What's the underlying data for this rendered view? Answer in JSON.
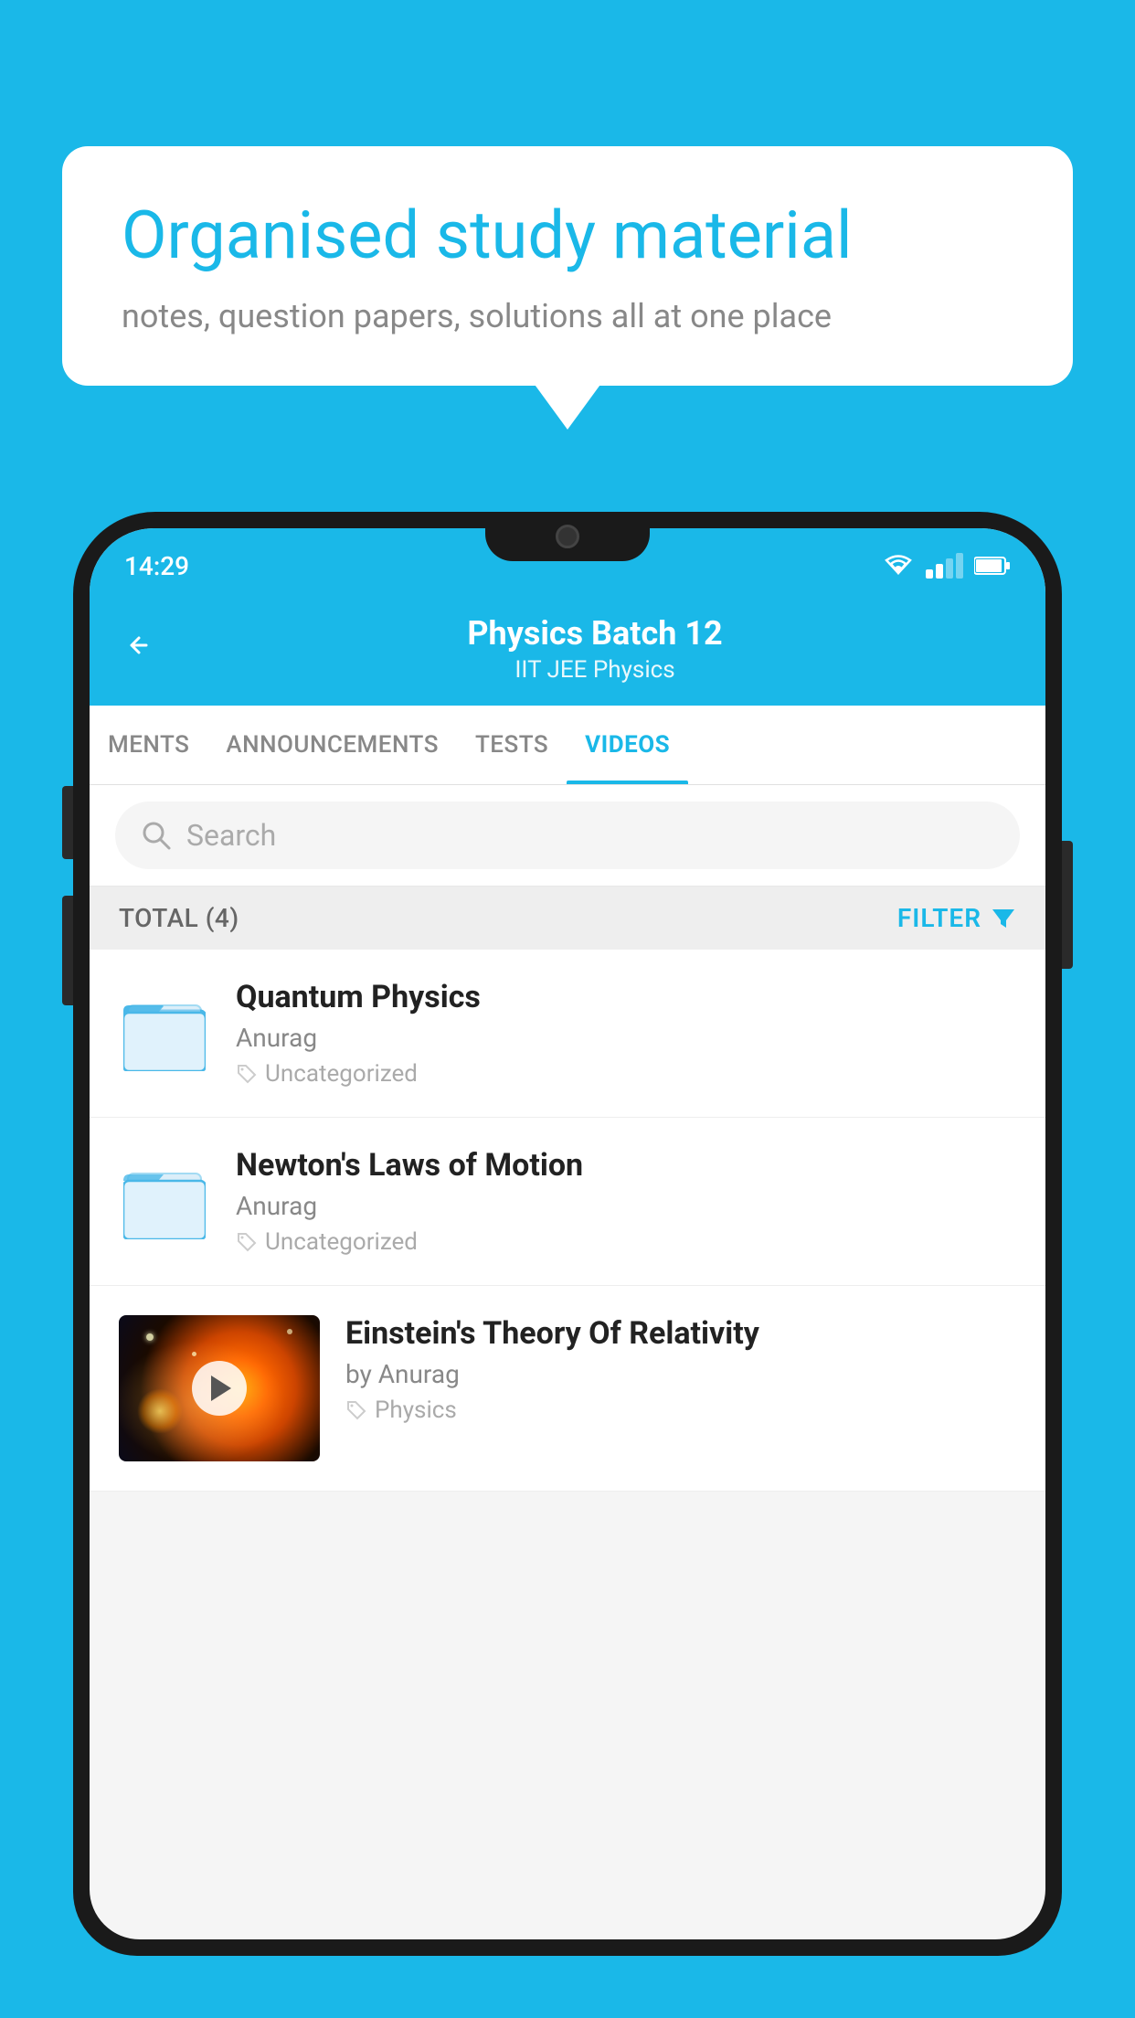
{
  "background_color": "#1ab8e8",
  "speech_bubble": {
    "title": "Organised study material",
    "subtitle": "notes, question papers, solutions all at one place"
  },
  "status_bar": {
    "time": "14:29"
  },
  "app_header": {
    "title": "Physics Batch 12",
    "subtitle": "IIT JEE   Physics",
    "back_label": "←"
  },
  "tabs": [
    {
      "label": "MENTS",
      "active": false
    },
    {
      "label": "ANNOUNCEMENTS",
      "active": false
    },
    {
      "label": "TESTS",
      "active": false
    },
    {
      "label": "VIDEOS",
      "active": true
    }
  ],
  "search": {
    "placeholder": "Search"
  },
  "filter_bar": {
    "total_label": "TOTAL (4)",
    "filter_label": "FILTER"
  },
  "videos": [
    {
      "title": "Quantum Physics",
      "author": "Anurag",
      "tag": "Uncategorized",
      "type": "folder"
    },
    {
      "title": "Newton's Laws of Motion",
      "author": "Anurag",
      "tag": "Uncategorized",
      "type": "folder"
    },
    {
      "title": "Einstein's Theory Of Relativity",
      "author": "by Anurag",
      "tag": "Physics",
      "type": "thumb"
    }
  ]
}
